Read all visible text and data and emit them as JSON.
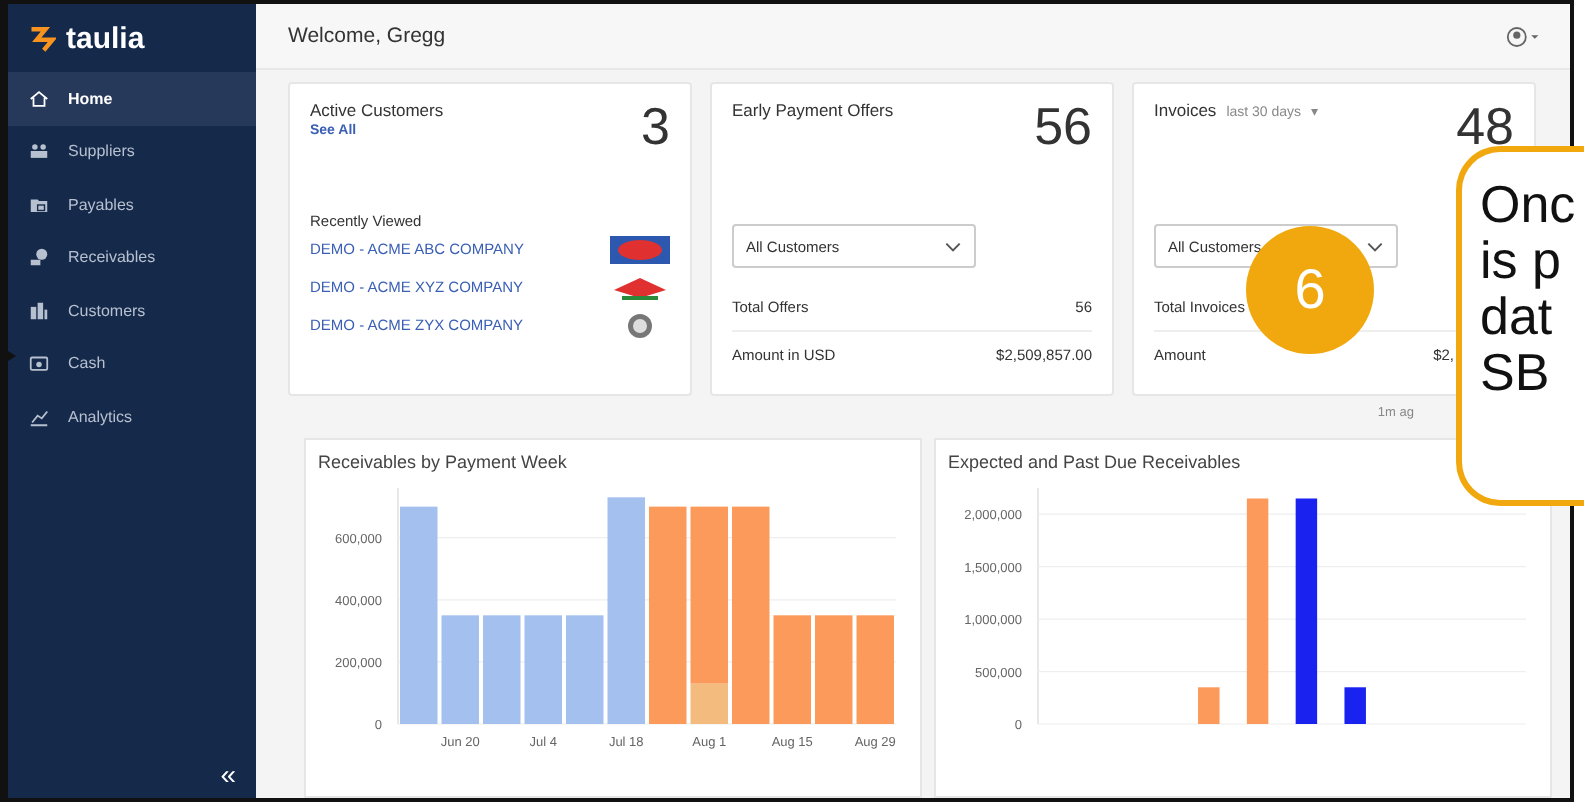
{
  "sidebar": {
    "logo": "taulia",
    "items": [
      {
        "label": "Home",
        "selected": true
      },
      {
        "label": "Suppliers",
        "selected": false
      },
      {
        "label": "Payables",
        "selected": false
      },
      {
        "label": "Receivables",
        "selected": false
      },
      {
        "label": "Customers",
        "selected": false
      },
      {
        "label": "Cash",
        "selected": false
      },
      {
        "label": "Analytics",
        "selected": false
      }
    ],
    "collapse": "«"
  },
  "header": {
    "welcome": "Welcome, Gregg"
  },
  "active_customers": {
    "title": "Active Customers",
    "link": "See All",
    "count": "3",
    "recent_heading": "Recently Viewed",
    "recent": [
      {
        "name": "DEMO - ACME ABC COMPANY"
      },
      {
        "name": "DEMO - ACME XYZ COMPANY"
      },
      {
        "name": "DEMO - ACME ZYX COMPANY"
      }
    ]
  },
  "early_payment_offers": {
    "title": "Early Payment Offers",
    "count": "56",
    "filter": "All Customers",
    "rows": [
      {
        "label": "Total Offers",
        "value": "56"
      },
      {
        "label": "Amount in USD",
        "value": "$2,509,857.00"
      }
    ]
  },
  "invoices": {
    "title": "Invoices",
    "period": "last 30 days",
    "period_caret": "▾",
    "count": "48",
    "filter": "All Customers",
    "rows": [
      {
        "label": "Total Invoices"
      },
      {
        "label": "Amount",
        "value": "$2,"
      }
    ]
  },
  "updated": "1m ag",
  "receivables_by_week": {
    "title": "Receivables by Payment Week",
    "chart_data": {
      "type": "bar",
      "stacked": true,
      "grid": true,
      "ylim": [
        0,
        760000
      ],
      "categories": [
        null,
        "Jun 20",
        null,
        "Jul 4",
        null,
        "Jul 18",
        null,
        "Aug 1",
        null,
        "Aug 15",
        null,
        "Aug 29"
      ],
      "yticks": [
        {
          "value": 0,
          "label": "0"
        },
        {
          "value": 200000,
          "label": "200,000"
        },
        {
          "value": 400000,
          "label": "400,000"
        },
        {
          "value": 600000,
          "label": "600,000"
        }
      ],
      "series": [
        {
          "color": "#a3c0ef",
          "values": [
            700000,
            350000,
            350000,
            350000,
            350000,
            730000,
            null,
            null,
            null,
            null,
            null,
            null
          ]
        },
        {
          "color": "#f3bb7e",
          "values": [
            null,
            null,
            null,
            null,
            null,
            null,
            null,
            130000,
            null,
            null,
            null,
            null
          ]
        },
        {
          "color": "#fb9a5b",
          "values": [
            null,
            null,
            null,
            null,
            null,
            null,
            700000,
            570000,
            700000,
            350000,
            350000,
            350000
          ]
        }
      ]
    }
  },
  "expected_past_due": {
    "title": "Expected and Past Due Receivables",
    "chart_data": {
      "type": "bar",
      "stacked": false,
      "grid": true,
      "ylim": [
        0,
        2250000
      ],
      "categories": [
        null,
        null,
        null,
        null,
        null,
        null,
        null,
        null,
        null,
        null
      ],
      "yticks": [
        {
          "value": 0,
          "label": "0"
        },
        {
          "value": 500000,
          "label": "500,000"
        },
        {
          "value": 1000000,
          "label": "1,000,000"
        },
        {
          "value": 1500000,
          "label": "1,500,000"
        },
        {
          "value": 2000000,
          "label": "2,000,000"
        }
      ],
      "series": [
        {
          "color": "#fb9a5b",
          "values": [
            null,
            null,
            null,
            350000,
            2150000,
            null,
            null,
            null,
            null,
            null
          ]
        },
        {
          "color": "#1a22f0",
          "values": [
            null,
            null,
            null,
            null,
            null,
            2150000,
            350000,
            null,
            null,
            null
          ]
        }
      ]
    }
  },
  "step_badge": "6",
  "callout": {
    "lines": [
      "Onc",
      "is p",
      "dat",
      "SB"
    ]
  }
}
